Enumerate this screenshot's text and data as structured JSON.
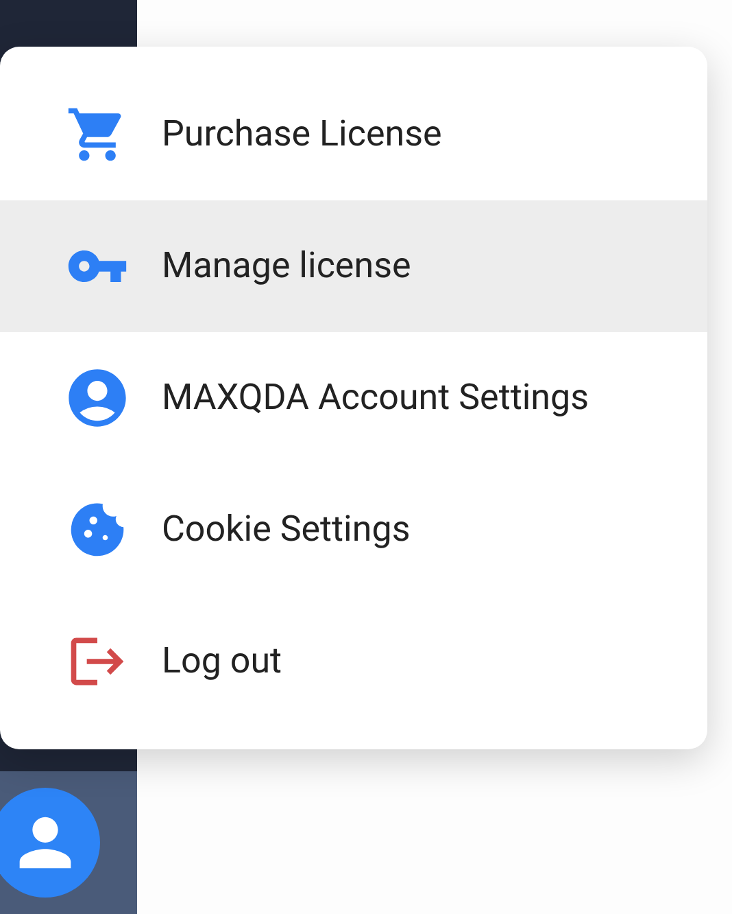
{
  "menu": {
    "items": [
      {
        "kind": "cart",
        "label": "Purchase License",
        "selected": false
      },
      {
        "kind": "key",
        "label": "Manage license",
        "selected": true
      },
      {
        "kind": "account",
        "label": "MAXQDA Account Settings",
        "selected": false
      },
      {
        "kind": "cookie",
        "label": "Cookie Settings",
        "selected": false
      },
      {
        "kind": "logout",
        "label": "Log out",
        "selected": false
      }
    ]
  }
}
